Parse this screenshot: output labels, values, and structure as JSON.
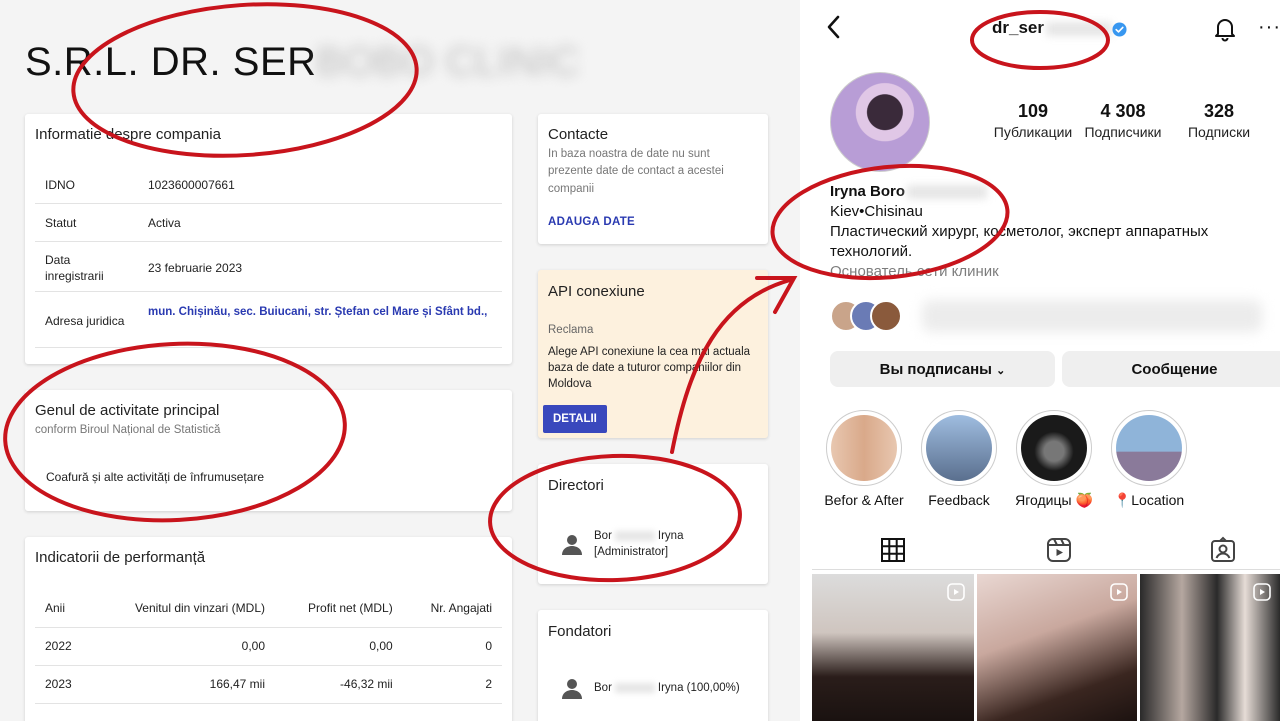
{
  "company": {
    "title_visible": "S.R.L. DR. SER",
    "title_hidden": "BOBO CLINIC",
    "info": {
      "heading": "Informatie despre compania",
      "rows": [
        {
          "key": "IDNO",
          "value": "1023600007661"
        },
        {
          "key": "Statut",
          "value": "Activa"
        },
        {
          "key": "Data inregistrarii",
          "value": "23 februarie 2023"
        },
        {
          "key": "Adresa juridica",
          "value": "mun. Chișinău, sec. Buiucani, str. Ștefan cel Mare și Sfânt bd.,"
        }
      ]
    },
    "activity": {
      "heading": "Genul de activitate principal",
      "subtitle": "conform Biroul Național de Statistică",
      "value": "Coafură și alte activități de înfrumusețare"
    },
    "performance": {
      "heading": "Indicatorii de performanță",
      "columns": [
        "Anii",
        "Venitul din vinzari (MDL)",
        "Profit net (MDL)",
        "Nr. Angajati"
      ],
      "rows": [
        [
          "2022",
          "0,00",
          "0,00",
          "0"
        ],
        [
          "2023",
          "166,47 mii",
          "-46,32 mii",
          "2"
        ]
      ]
    },
    "contact": {
      "heading": "Contacte",
      "text": "In baza noastra de date nu sunt prezente date de contact a acestei companii",
      "action": "ADAUGA DATE"
    },
    "api": {
      "heading": "API conexiune",
      "tag": "Reclama",
      "text": "Alege API conexiune la cea mai actuala baza de date a tuturor companiilor din Moldova",
      "button": "DETALII"
    },
    "directors": {
      "heading": "Directori",
      "name_start": "Bor",
      "name_end": "Iryna",
      "role": "[Administrator]"
    },
    "founders": {
      "heading": "Fondatori",
      "name_start": "Bor",
      "name_end": "Iryna (100,00%)"
    }
  },
  "instagram": {
    "handle": "dr_ser",
    "stats": [
      {
        "value": "109",
        "label": "Публикации"
      },
      {
        "value": "4 308",
        "label": "Подписчики"
      },
      {
        "value": "328",
        "label": "Подписки"
      }
    ],
    "bio": {
      "name": "Iryna Boro",
      "location": "Kiev•Chisinau",
      "line1": "Пластический хирург, косметолог, эксперт аппаратных",
      "line2": "технологий.",
      "line3": "Основатель сети клиник"
    },
    "buttons": {
      "following": "Вы подписаны",
      "message": "Сообщение"
    },
    "highlights": [
      {
        "label": "Befor & After",
        "color": "#e8c7b0"
      },
      {
        "label": "Feedback",
        "color": "#7f9fc3"
      },
      {
        "label": "Ягодицы 🍑",
        "color": "#1a1a1a"
      },
      {
        "label": "📍Location",
        "color": "#8fb4d9"
      }
    ]
  },
  "colors": {
    "annotation": "#c8141c",
    "link": "#2a3ab1",
    "api_bg": "#fdf1de",
    "button": "#3948bd",
    "verified": "#3897f0"
  }
}
